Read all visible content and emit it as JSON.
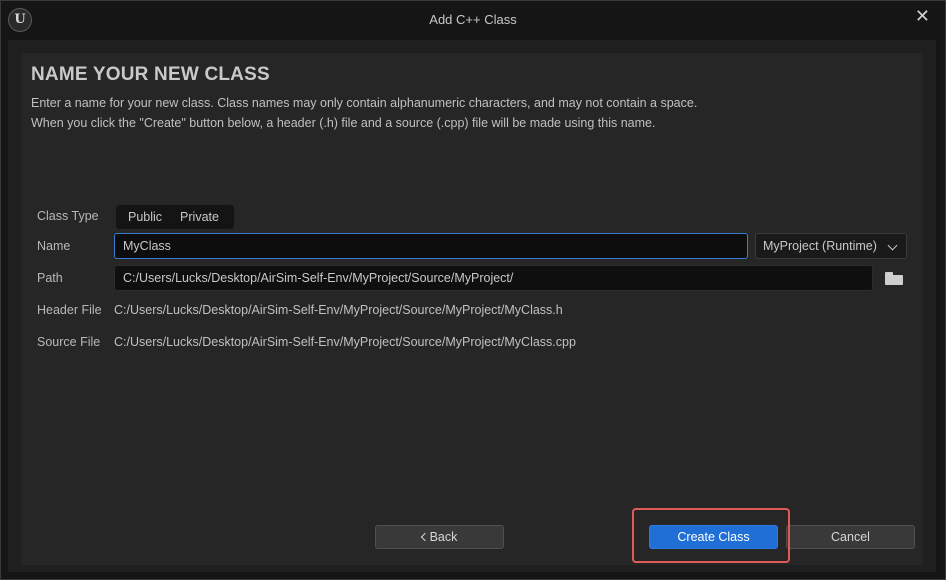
{
  "window": {
    "title": "Add C++ Class",
    "logo_text": "U",
    "close_glyph": "✕"
  },
  "header": {
    "heading": "NAME YOUR NEW CLASS",
    "description_line1": "Enter a name for your new class. Class names may only contain alphanumeric characters, and may not contain a space.",
    "description_line2": "When you click the \"Create\" button below, a header (.h) file and a source (.cpp) file will be made using this name."
  },
  "form": {
    "class_type": {
      "label": "Class Type",
      "options": [
        "Public",
        "Private"
      ]
    },
    "name": {
      "label": "Name",
      "value": "MyClass"
    },
    "module": {
      "selected": "MyProject (Runtime)"
    },
    "path": {
      "label": "Path",
      "value": "C:/Users/Lucks/Desktop/AirSim-Self-Env/MyProject/Source/MyProject/"
    },
    "header_file": {
      "label": "Header File",
      "value": "C:/Users/Lucks/Desktop/AirSim-Self-Env/MyProject/Source/MyProject/MyClass.h"
    },
    "source_file": {
      "label": "Source File",
      "value": "C:/Users/Lucks/Desktop/AirSim-Self-Env/MyProject/Source/MyProject/MyClass.cpp"
    }
  },
  "buttons": {
    "back": "Back",
    "create": "Create Class",
    "cancel": "Cancel"
  },
  "colors": {
    "accent": "#1f6fd6",
    "highlight": "#e05a5a",
    "panel": "#262626"
  }
}
